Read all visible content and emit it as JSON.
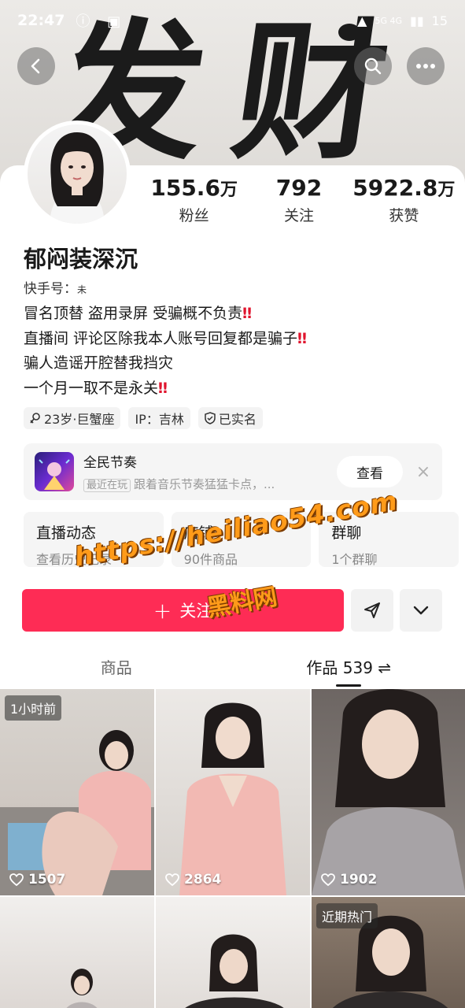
{
  "status_bar": {
    "time": "22:47",
    "battery": "15",
    "network_labels": "5G  4G"
  },
  "banner": {
    "calligraphy_left": "发",
    "calligraphy_right": "财"
  },
  "profile": {
    "stats": [
      {
        "num": "155.6",
        "unit": "万",
        "label": "粉丝"
      },
      {
        "num": "792",
        "unit": "",
        "label": "关注"
      },
      {
        "num": "5922.8",
        "unit": "万",
        "label": "获赞"
      }
    ],
    "nickname": "郁闷装深沉",
    "account_id_label": "快手号：",
    "account_id_value": "未",
    "bio_lines": [
      {
        "text": "冒名顶替 盗用录屏 受骗概不负责",
        "mark": "‼"
      },
      {
        "text": "直播间 评论区除我本人账号回复都是骗子",
        "mark": "‼"
      },
      {
        "text": "骗人造谣开腔替我挡灾",
        "mark": ""
      },
      {
        "text": "一个月一取不是永关",
        "mark": "‼"
      }
    ],
    "tags": [
      {
        "icon": "female-icon",
        "text": "23岁·巨蟹座"
      },
      {
        "icon": "",
        "text": "IP：吉林"
      },
      {
        "icon": "verified-shield-icon",
        "text": "已实名"
      }
    ]
  },
  "game_card": {
    "title": "全民节奏",
    "badge": "最近在玩",
    "subtitle": "跟着音乐节奏猛猛卡点，...",
    "view_label": "查看",
    "close": "×"
  },
  "info_cards": [
    {
      "title": "直播动态",
      "sub": "查看历史记录"
    },
    {
      "title": "店铺",
      "sub": "90件商品"
    },
    {
      "title": "群聊",
      "sub": "1个群聊"
    }
  ],
  "actions": {
    "follow_label": "关注",
    "plus": "+"
  },
  "watermark": {
    "url": "https://heiliao54.com",
    "name": "黑料网"
  },
  "tabs": [
    {
      "label": "商品",
      "active": false
    },
    {
      "label": "作品 539 ⇌",
      "active": true
    }
  ],
  "posts": [
    {
      "badge": "1小时前",
      "likes": "1507"
    },
    {
      "badge": "",
      "likes": "2864"
    },
    {
      "badge": "",
      "likes": "1902"
    },
    {
      "badge": "",
      "likes": ""
    },
    {
      "badge": "",
      "likes": ""
    },
    {
      "badge": "近期热门",
      "likes": ""
    }
  ],
  "colors": {
    "accent": "#fe2c55",
    "watermark": "#ff9b1a"
  }
}
